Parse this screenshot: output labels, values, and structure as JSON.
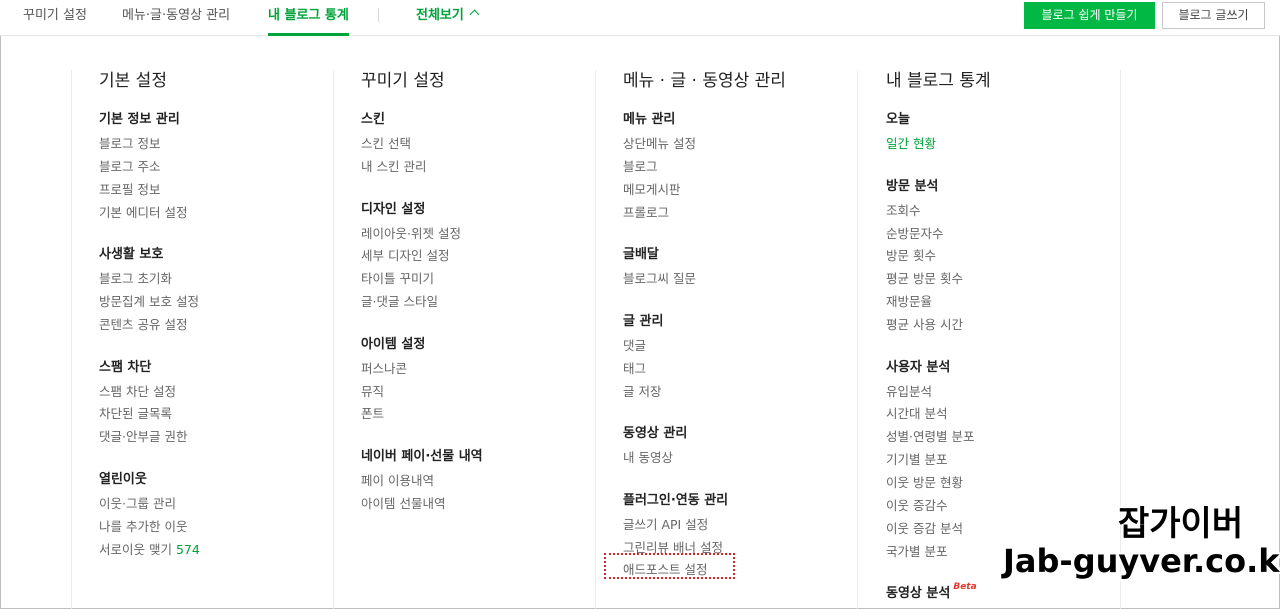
{
  "nav": {
    "tab_decorate": "꾸미기 설정",
    "tab_menu": "메뉴·글·동영상 관리",
    "tab_stats": "내 블로그 통계",
    "view_all": "전체보기",
    "btn_easy": "블로그 쉽게 만들기",
    "btn_write": "블로그 글쓰기"
  },
  "col1": {
    "title": "기본 설정",
    "sections": [
      {
        "title": "기본 정보 관리",
        "links": [
          "블로그 정보",
          "블로그 주소",
          "프로필 정보",
          "기본 에디터 설정"
        ]
      },
      {
        "title": "사생활 보호",
        "links": [
          "블로그 초기화",
          "방문집계 보호 설정",
          "콘텐츠 공유 설정"
        ]
      },
      {
        "title": "스팸 차단",
        "links": [
          "스팸 차단 설정",
          "차단된 글목록",
          "댓글·안부글 권한"
        ]
      },
      {
        "title": "열린이웃",
        "links": [
          "이웃·그룹 관리",
          "나를 추가한 이웃",
          "서로이웃 맺기"
        ],
        "count": "574"
      }
    ]
  },
  "col2": {
    "title": "꾸미기 설정",
    "sections": [
      {
        "title": "스킨",
        "links": [
          "스킨 선택",
          "내 스킨 관리"
        ]
      },
      {
        "title": "디자인 설정",
        "links": [
          "레이아웃·위젯 설정",
          "세부 디자인 설정",
          "타이틀 꾸미기",
          "글·댓글 스타일"
        ]
      },
      {
        "title": "아이템 설정",
        "links": [
          "퍼스나콘",
          "뮤직",
          "폰트"
        ]
      },
      {
        "title": "네이버 페이·선물 내역",
        "links": [
          "페이 이용내역",
          "아이템 선물내역"
        ]
      }
    ]
  },
  "col3": {
    "title": "메뉴 · 글 · 동영상 관리",
    "sections": [
      {
        "title": "메뉴 관리",
        "links": [
          "상단메뉴 설정",
          "블로그",
          "메모게시판",
          "프롤로그"
        ]
      },
      {
        "title": "글배달",
        "links": [
          "블로그씨 질문"
        ]
      },
      {
        "title": "글 관리",
        "links": [
          "댓글",
          "태그",
          "글 저장"
        ]
      },
      {
        "title": "동영상 관리",
        "links": [
          "내 동영상"
        ]
      },
      {
        "title": "플러그인·연동 관리",
        "links": [
          "글쓰기 API 설정",
          "그린리뷰 배너 설정",
          "애드포스트 설정"
        ]
      }
    ]
  },
  "col4": {
    "title": "내 블로그 통계",
    "sections": [
      {
        "title": "오늘",
        "links": [
          "일간 현황"
        ]
      },
      {
        "title": "방문 분석",
        "links": [
          "조회수",
          "순방문자수",
          "방문 횟수",
          "평균 방문 횟수",
          "재방문율",
          "평균 사용 시간"
        ]
      },
      {
        "title": "사용자 분석",
        "links": [
          "유입분석",
          "시간대 분석",
          "성별·연령별 분포",
          "기기별 분포",
          "이웃 방문 현황",
          "이웃 증감수",
          "이웃 증감 분석",
          "국가별 분포"
        ]
      },
      {
        "title": "동영상 분석",
        "links": [],
        "badge": "Beta"
      }
    ]
  },
  "watermark": {
    "line1": "잡가이버",
    "line2": "Jab-guyver.co.kr"
  },
  "colors": {
    "accent": "#00a33a",
    "button_green": "#00b843",
    "highlight_box": "#d0262a"
  }
}
